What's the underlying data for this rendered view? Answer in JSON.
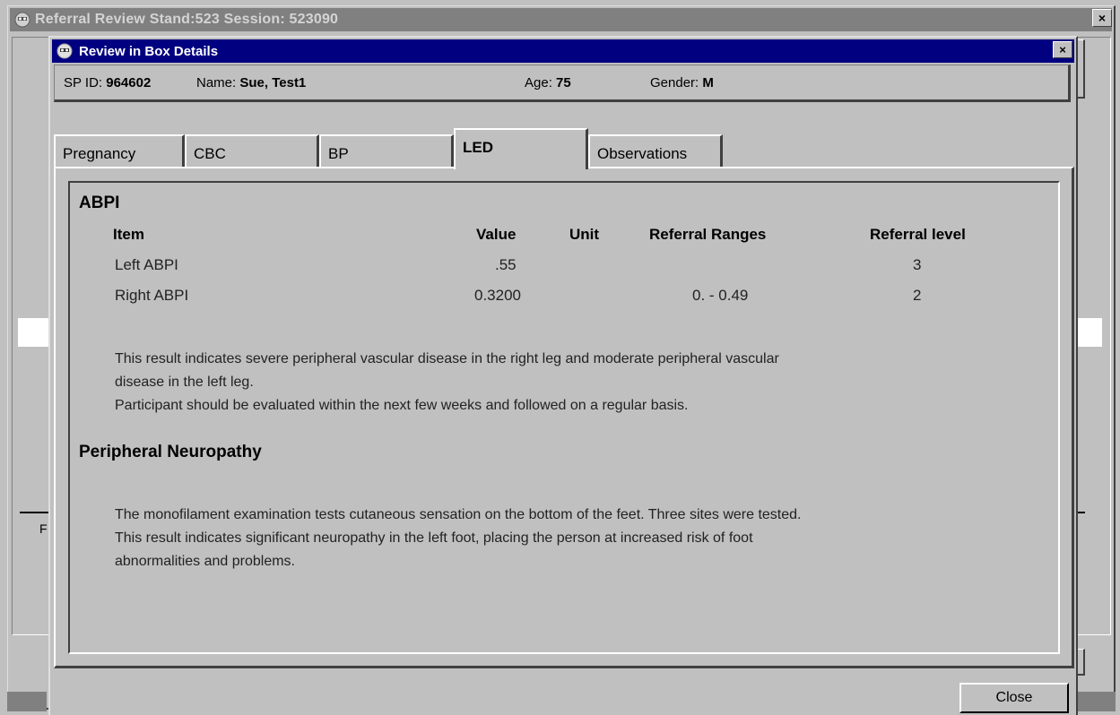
{
  "parent_window": {
    "title": "Referral Review Stand:523 Session: 523090",
    "close_glyph": "×",
    "fragment_label": "F"
  },
  "dialog": {
    "title": "Review in Box Details",
    "close_glyph": "×"
  },
  "participant": {
    "spid_label": "SP ID:",
    "spid_value": "964602",
    "name_label": "Name:",
    "name_value": "Sue, Test1",
    "age_label": "Age:",
    "age_value": "75",
    "gender_label": "Gender:",
    "gender_value": "M"
  },
  "tabs": [
    {
      "label": "Pregnancy",
      "active": false
    },
    {
      "label": "CBC",
      "active": false
    },
    {
      "label": "BP",
      "active": false
    },
    {
      "label": "LED",
      "active": true
    },
    {
      "label": "Observations",
      "active": false
    }
  ],
  "abpi": {
    "title": "ABPI",
    "headers": {
      "item": "Item",
      "value": "Value",
      "unit": "Unit",
      "ranges": "Referral Ranges",
      "level": "Referral level"
    },
    "rows": [
      {
        "item": "Left ABPI",
        "value": ".55",
        "unit": "",
        "ranges": "",
        "level": "3"
      },
      {
        "item": "Right ABPI",
        "value": "0.3200",
        "unit": "",
        "ranges": "0. - 0.49",
        "level": "2"
      }
    ],
    "text_lines": [
      "This result indicates severe peripheral vascular disease in the right leg and moderate peripheral vascular",
      "disease in the left leg.",
      "Participant should be evaluated within the next few weeks and followed on a regular basis."
    ]
  },
  "neuropathy": {
    "title": "Peripheral Neuropathy",
    "text_lines": [
      "The monofilament examination tests cutaneous sensation on the bottom of the feet. Three sites were tested.",
      "This result indicates significant neuropathy in the left foot, placing the person at increased risk of foot",
      "abnormalities and problems."
    ]
  },
  "buttons": {
    "close": "Close"
  },
  "colors": {
    "window_bg": "#c0c0c0",
    "active_title": "#000080",
    "inactive_title": "#808080"
  }
}
